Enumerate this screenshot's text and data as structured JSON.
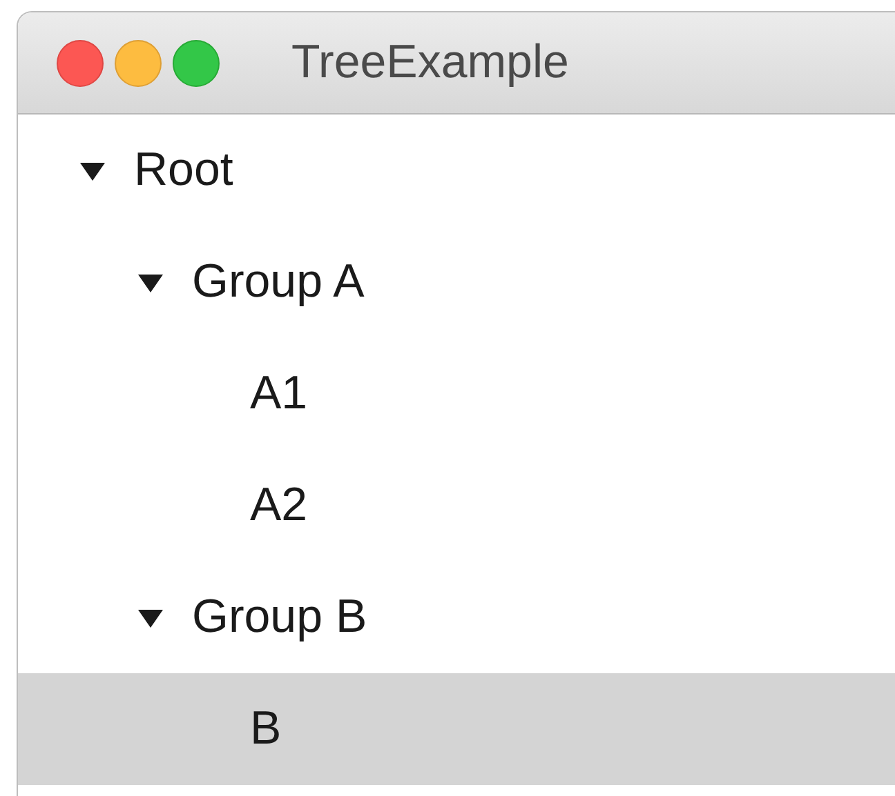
{
  "window": {
    "title": "TreeExample"
  },
  "tree": [
    {
      "label": "Root",
      "expanded": true,
      "selected": false,
      "children": [
        {
          "label": "Group A",
          "expanded": true,
          "selected": false,
          "children": [
            {
              "label": "A1",
              "selected": false
            },
            {
              "label": "A2",
              "selected": false
            }
          ]
        },
        {
          "label": "Group B",
          "expanded": true,
          "selected": false,
          "children": [
            {
              "label": "B",
              "selected": true
            }
          ]
        }
      ]
    }
  ]
}
